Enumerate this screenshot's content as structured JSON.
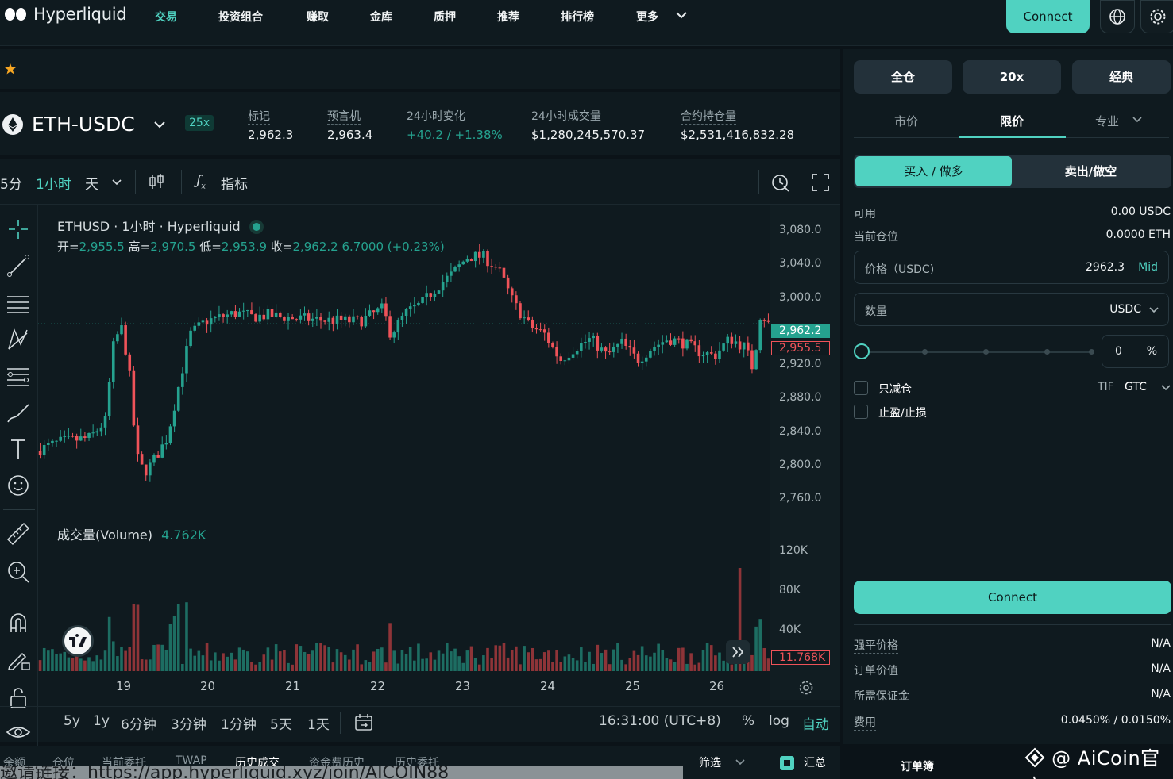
{
  "nav": {
    "brand": "Hyperliquid",
    "items": [
      "交易",
      "投资组合",
      "赚取",
      "金库",
      "质押",
      "推荐",
      "排行榜",
      "更多"
    ],
    "connect": "Connect"
  },
  "pair": {
    "symbol": "ETH-USDC",
    "leverage": "25x",
    "stats": [
      {
        "label": "标记",
        "value": "2,962.3"
      },
      {
        "label": "预言机",
        "value": "2,963.4"
      },
      {
        "label": "24小时变化",
        "value": "+40.2 / +1.38%"
      },
      {
        "label": "24小时成交量",
        "value": "$1,280,245,570.37"
      },
      {
        "label": "合约持仓量",
        "value": "$2,531,416,832.28"
      }
    ]
  },
  "toolbar": {
    "intervals": [
      "5分",
      "1小时",
      "天"
    ],
    "indicators": "指标"
  },
  "legend": {
    "title": "ETHUSD · 1小时 · Hyperliquid",
    "open_l": "开=",
    "open_v": "2,955.5",
    "high_l": "高=",
    "high_v": "2,970.5",
    "low_l": "低=",
    "low_v": "2,953.9",
    "close_l": "收=",
    "close_v": "2,962.2",
    "change": "6.7000 (+0.23%)"
  },
  "volume_legend": {
    "label": "成交量(Volume)",
    "value": "4.762K"
  },
  "chart_data": {
    "type": "candlestick",
    "price_axis": [
      "3,080.0",
      "3,040.0",
      "3,000.0",
      "2,920.0",
      "2,880.0",
      "2,840.0",
      "2,800.0",
      "2,760.0"
    ],
    "price_tags": {
      "last": "2,962.2",
      "ref": "2,955.5"
    },
    "volume_axis": [
      "120K",
      "80K",
      "40K"
    ],
    "volume_tag": "11.768K",
    "x_labels": [
      "19",
      "20",
      "21",
      "22",
      "23",
      "24",
      "25",
      "26"
    ],
    "path_points": [
      [
        0,
        2815
      ],
      [
        3,
        2825
      ],
      [
        7,
        2830
      ],
      [
        9,
        2850
      ],
      [
        10,
        2935
      ],
      [
        11,
        2960
      ],
      [
        12,
        2915
      ],
      [
        13,
        2810
      ],
      [
        14,
        2790
      ],
      [
        15,
        2800
      ],
      [
        17,
        2830
      ],
      [
        18,
        2870
      ],
      [
        19,
        2910
      ],
      [
        20,
        2950
      ],
      [
        22,
        2965
      ],
      [
        24,
        2970
      ],
      [
        26,
        2975
      ],
      [
        28,
        2970
      ],
      [
        30,
        2972
      ],
      [
        34,
        2968
      ],
      [
        38,
        2966
      ],
      [
        42,
        2965
      ],
      [
        45,
        2980
      ],
      [
        46,
        2950
      ],
      [
        48,
        2975
      ],
      [
        50,
        2985
      ],
      [
        52,
        3005
      ],
      [
        54,
        3020
      ],
      [
        56,
        3040
      ],
      [
        58,
        3040
      ],
      [
        60,
        3025
      ],
      [
        62,
        2985
      ],
      [
        64,
        2960
      ],
      [
        66,
        2950
      ],
      [
        68,
        2920
      ],
      [
        70,
        2935
      ],
      [
        72,
        2945
      ],
      [
        74,
        2925
      ],
      [
        76,
        2940
      ],
      [
        78,
        2920
      ],
      [
        80,
        2935
      ],
      [
        82,
        2945
      ],
      [
        84,
        2940
      ],
      [
        86,
        2930
      ],
      [
        88,
        2925
      ],
      [
        90,
        2945
      ],
      [
        92,
        2935
      ],
      [
        93,
        2910
      ],
      [
        94,
        2975
      ],
      [
        95,
        2962
      ]
    ]
  },
  "bottom_toolbar": {
    "ranges": [
      "5y",
      "1y",
      "6分钟",
      "3分钟",
      "1分钟",
      "5天",
      "1天"
    ],
    "time": "16:31:00 (UTC+8)",
    "percent": "%",
    "log": "log",
    "auto": "自动"
  },
  "bottom_tabs": {
    "items": [
      "余额",
      "仓位",
      "当前委托",
      "TWAP",
      "历史成交",
      "资金费历史",
      "历史委托"
    ],
    "filter": "筛选",
    "summary": "汇总"
  },
  "panel": {
    "margin_mode": "全仓",
    "leverage": "20x",
    "mode": "经典",
    "order_types": [
      "市价",
      "限价",
      "专业"
    ],
    "buy": "买入 / 做多",
    "sell": "卖出/做空",
    "available_label": "可用",
    "available_value": "0.00 USDC",
    "position_label": "当前仓位",
    "position_value": "0.0000 ETH",
    "price_label": "价格（USDC)",
    "price_value": "2962.3",
    "price_mid": "Mid",
    "size_label": "数量",
    "size_unit": "USDC",
    "slider_pct": "0",
    "pct_sign": "%",
    "reduce_only": "只减仓",
    "tpsl": "止盈/止损",
    "tif_label": "TIF",
    "tif_value": "GTC",
    "connect": "Connect",
    "info": [
      {
        "label": "强平价格",
        "value": "N/A"
      },
      {
        "label": "订单价值",
        "value": "N/A"
      },
      {
        "label": "所需保证金",
        "value": "N/A"
      },
      {
        "label": "费用",
        "value": "0.0450% / 0.0150%"
      }
    ],
    "orderbook": "订单簿"
  },
  "watermark": "@ AiCoin官方",
  "ref_text": "邀请链接：https://app.hyperliquid.xyz/join/AICOIN88",
  "colors": {
    "accent": "#50d2c1",
    "up": "#25a28f",
    "down": "#ef5359",
    "bg": "#0b1318",
    "panel": "#0f1a1f"
  }
}
